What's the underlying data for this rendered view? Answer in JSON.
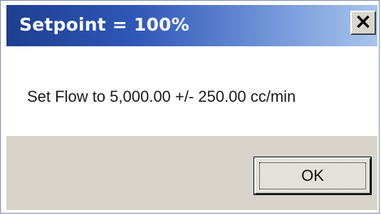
{
  "window": {
    "title": "Setpoint = 100%",
    "close_glyph": "✕",
    "titlebar_colors": [
      "#1e3f8f",
      "#a9c4ec"
    ]
  },
  "message": {
    "text": "Set Flow to 5,000.00 +/- 250.00 cc/min"
  },
  "buttons": {
    "ok_label": "OK"
  },
  "icons": {
    "close": "close-icon"
  },
  "colors": {
    "footer_background": "#d8d4cc",
    "dialog_background": "#ffffff"
  }
}
